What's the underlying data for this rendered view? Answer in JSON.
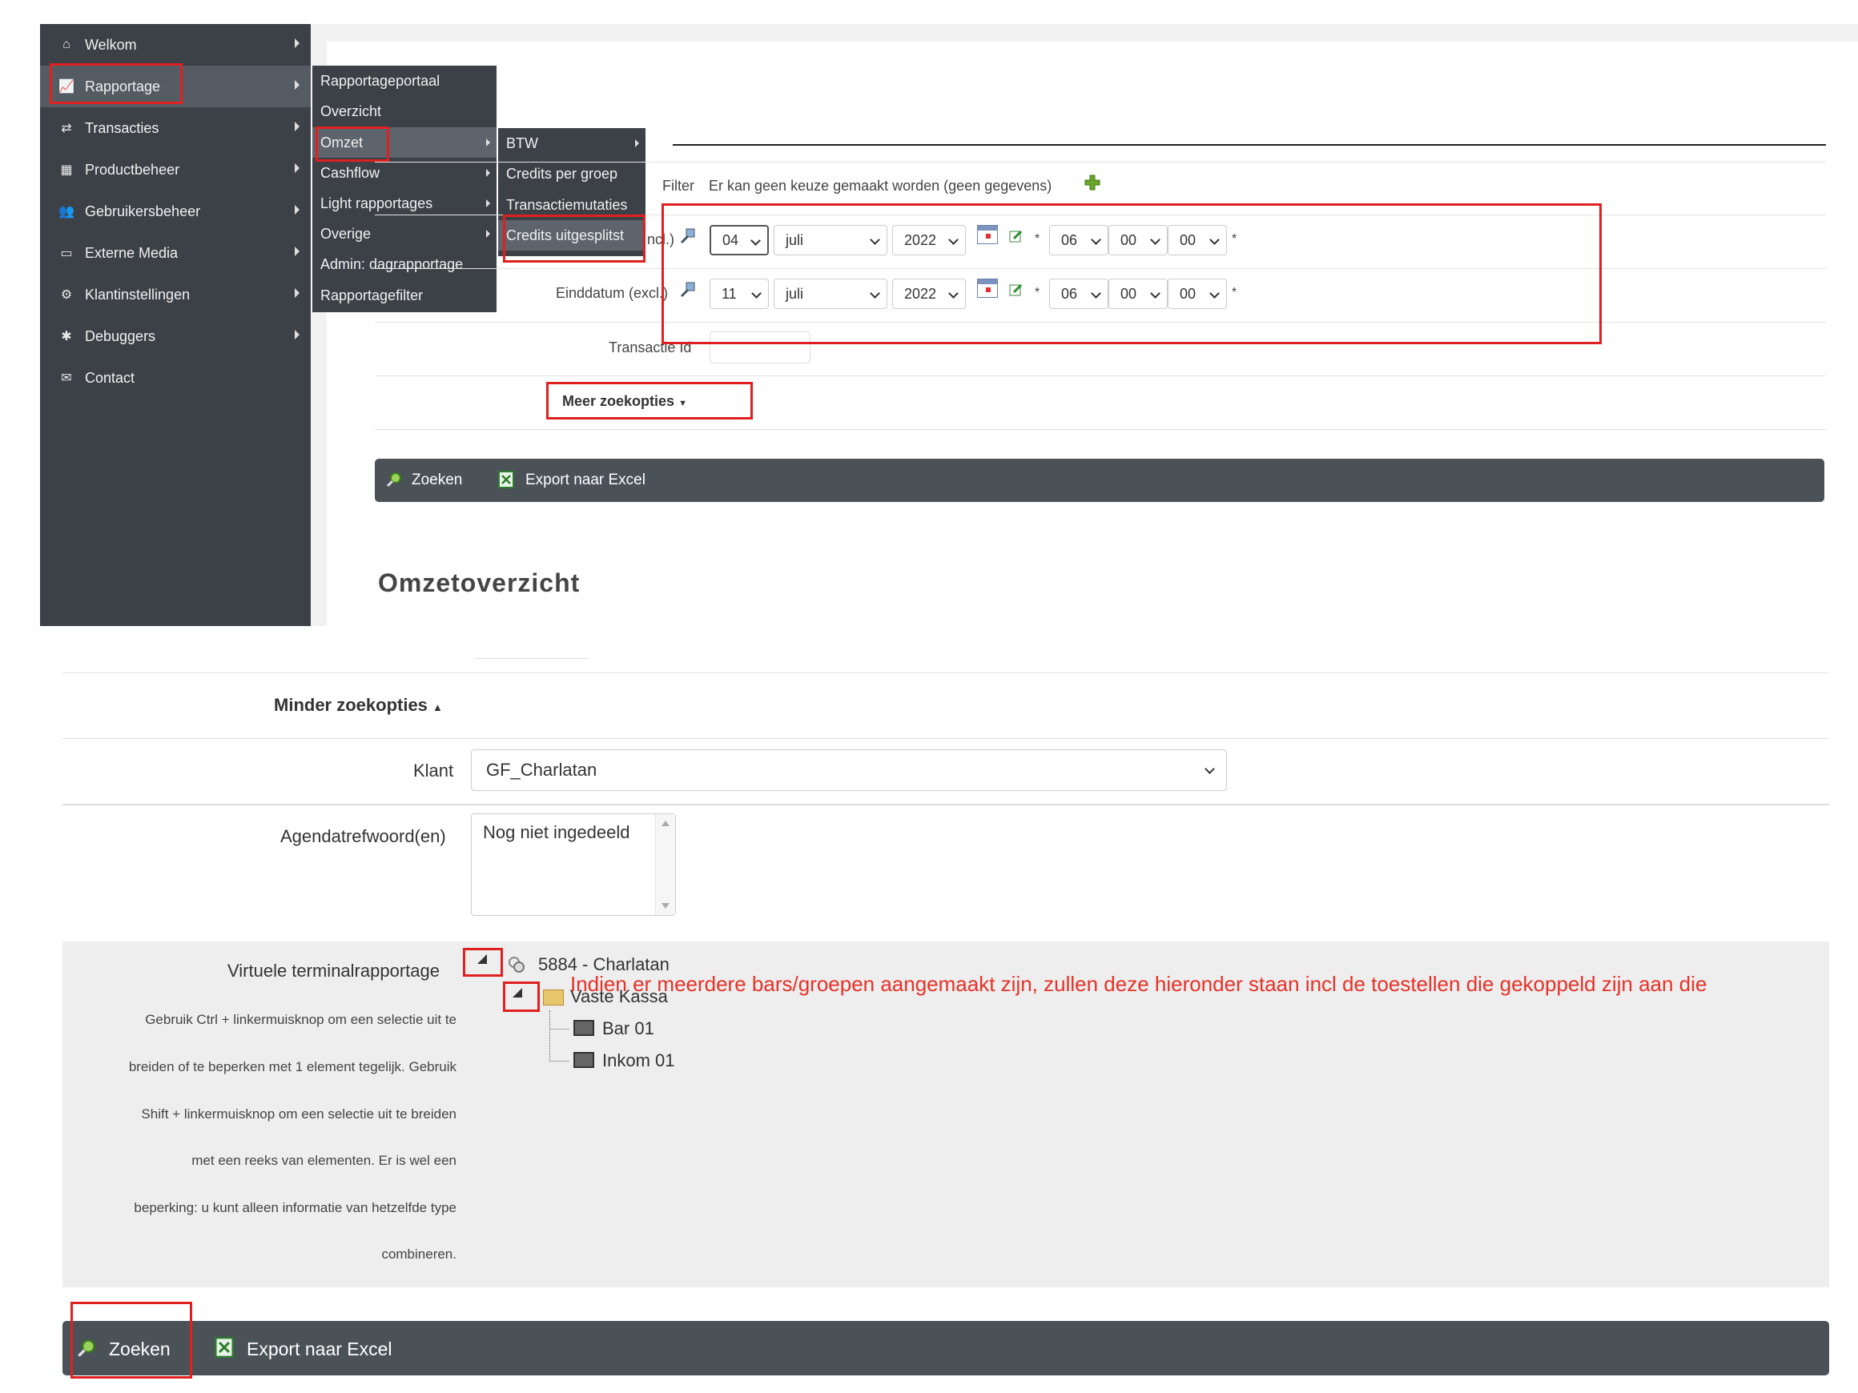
{
  "sidebar": {
    "items": [
      {
        "label": "Welkom",
        "icon": "home-icon"
      },
      {
        "label": "Rapportage",
        "icon": "chart-line-icon"
      },
      {
        "label": "Transacties",
        "icon": "exchange-icon"
      },
      {
        "label": "Productbeheer",
        "icon": "basket-icon"
      },
      {
        "label": "Gebruikersbeheer",
        "icon": "users-icon"
      },
      {
        "label": "Externe Media",
        "icon": "monitor-icon"
      },
      {
        "label": "Klantinstellingen",
        "icon": "cogs-icon"
      },
      {
        "label": "Debuggers",
        "icon": "bug-icon"
      },
      {
        "label": "Contact",
        "icon": "envelope-icon"
      }
    ]
  },
  "submenu": {
    "items": [
      "Rapportageportaal",
      "Overzicht",
      "Omzet",
      "Cashflow",
      "Light rapportages",
      "Overige",
      "Admin: dagrapportage",
      "Rapportagefilter"
    ]
  },
  "omzet_menu": {
    "items": [
      "BTW",
      "Credits per groep",
      "Transactiemutaties",
      "Credits uitgesplitst"
    ]
  },
  "filter": {
    "label": "Filter",
    "text": "Er kan geen keuze gemaakt worden (geen gegevens)"
  },
  "startdate": {
    "label_partial": "ncl.)",
    "day": "04",
    "month": "juli",
    "year": "2022",
    "hour": "06",
    "minute": "00",
    "second": "00"
  },
  "enddate": {
    "label": "Einddatum (excl.)",
    "day": "11",
    "month": "juli",
    "year": "2022",
    "hour": "06",
    "minute": "00",
    "second": "00"
  },
  "required_mark": "*",
  "transaction_id": {
    "label": "Transactie Id",
    "value": ""
  },
  "more_options": "Meer zoekopties",
  "toolbar_top": {
    "search": "Zoeken",
    "export": "Export naar Excel"
  },
  "report_title": "Omzetoverzicht",
  "less_options": "Minder zoekopties",
  "klant": {
    "label": "Klant",
    "value": "GF_Charlatan"
  },
  "agenda": {
    "label": "Agendatrefwoord(en)",
    "value": "Nog niet ingedeeld"
  },
  "virtual_terminal": {
    "label": "Virtuele terminalrapportage",
    "help_lines": [
      "Gebruik Ctrl + linkermuisknop om een selectie uit te",
      "breiden of te beperken met 1 element tegelijk. Gebruik",
      "Shift + linkermuisknop om een selectie uit te breiden",
      "met een reeks van elementen. Er is wel een",
      "beperking: u kunt alleen informatie van hetzelfde type",
      "combineren."
    ],
    "tree": {
      "root": "5884 - Charlatan",
      "group": "Vaste Kassa",
      "devices": [
        "Bar 01",
        "Inkom 01"
      ]
    }
  },
  "annotation": "Indien er meerdere bars/groepen aangemaakt zijn, zullen deze hieronder staan incl de toestellen die gekoppeld zijn aan die",
  "toolbar_bottom": {
    "search": "Zoeken",
    "export": "Export naar Excel"
  },
  "colors": {
    "sidebar": "#3c4147",
    "toolbar": "#4a5157",
    "highlight": "#e02020"
  }
}
